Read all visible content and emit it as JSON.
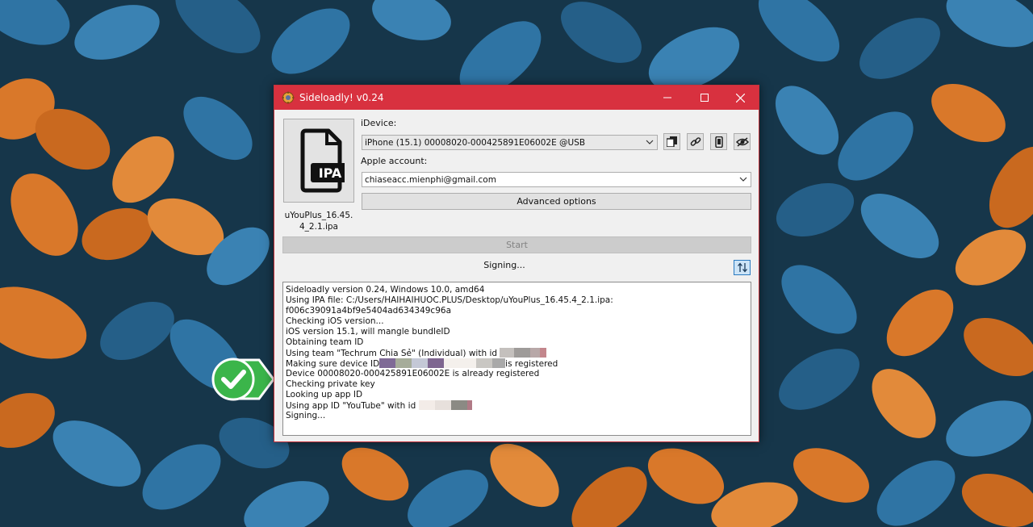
{
  "window": {
    "title": "Sideloadly! v0.24"
  },
  "ipa": {
    "icon": "ipa-file-icon",
    "badge_text": "IPA",
    "file_name": "uYouPlus_16.45.4_2.1.ipa"
  },
  "idevice": {
    "label": "iDevice:",
    "selected": "iPhone (15.1) 00008020-000425891E06002E @USB"
  },
  "apple_account": {
    "label": "Apple account:",
    "selected": "chiaseacc.mienphi@gmail.com"
  },
  "buttons": {
    "advanced": "Advanced options",
    "start": "Start"
  },
  "status": "Signing...",
  "log": {
    "lines": [
      "Sideloadly version 0.24, Windows 10.0, amd64",
      "Using IPA file: C:/Users/HAIHAIHUOC.PLUS/Desktop/uYouPlus_16.45.4_2.1.ipa:",
      "f006c39091a4bf9e5404ad634349c96a",
      "Checking iOS version...",
      "iOS version 15.1, will mangle bundleID",
      "Obtaining team ID",
      "Using team \"Techrum Chia Sẻ\" (Individual) with id",
      "Making sure device ID",
      "is registered",
      "Device 00008020-000425891E06002E is already registered",
      "Checking private key",
      "Looking up app ID",
      "Using app ID \"YouTube\" with id",
      "Signing..."
    ]
  },
  "colors": {
    "titlebar": "#d8313f",
    "badge_green": "#3bb54a"
  }
}
